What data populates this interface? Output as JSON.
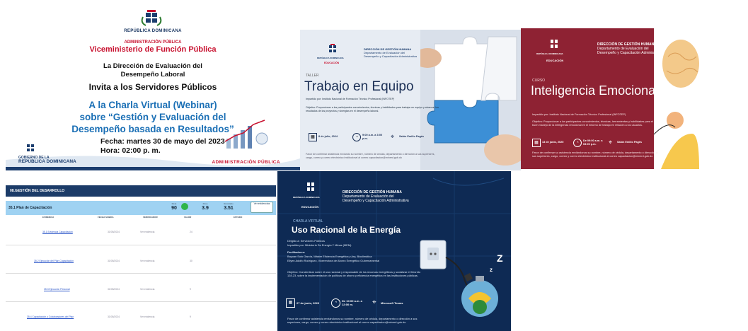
{
  "webinar": {
    "republica": "REPÚBLICA DOMINICANA",
    "administracion": "ADMINISTRACIÓN PÚBLICA",
    "viceministerio": "Viceministerio de Función Pública",
    "direccion_line1": "La Dirección de Evaluación del",
    "direccion_line2": "Desempeño Laboral",
    "invita": "Invita a los Servidores Públicos",
    "charla_line1": "A la Charla Virtual (Webinar)",
    "charla_line2": "sobre “Gestión y Evaluación del",
    "charla_line3": "Desempeño basada en Resultados”",
    "fecha": "Fecha: martes 30 de mayo del 2023",
    "hora": "Hora: 02:00 p. m.",
    "gobierno": "GOBIERNO DE LA",
    "gobierno_rd": "REPÚBLICA DOMINICANA",
    "footer_admin": "ADMINISTRACIÓN PÚBLICA",
    "colors": {
      "red": "#c8102e",
      "blue": "#1a6fb5"
    }
  },
  "trabajo": {
    "republica": "REPÚBLICA DOMINICANA",
    "educacion": "EDUCACIÓN",
    "dgh_line1": "DIRECCIÓN DE GESTIÓN HUMANA",
    "dgh_line2": "Departamento de Evaluación del",
    "dgh_line3": "Desempeño y Capacitación Administrativa",
    "taller": "TALLER",
    "title": "Trabajo en Equipo",
    "impartido": "Impartido por: Instituto Nacional de Formación Técnico Profesional (INFOTEP)",
    "objetivo": "Objetivo: Proporcionar a los participantes conocimientos, técnicas y habilidades para trabajar en equipo y alcanzar los resultados de los proyectos y sinergias en el desempeño laboral.",
    "fecha": "8 de julio, 2024",
    "hora": "9:00 a.m. a 3:00 p.m.",
    "lugar": "Salón Emilio Pagés",
    "nota": "Favor de confirmar asistencia enviando su nombre, número de cédula, departamento o dirección a sus superiores, cargo, correo y correo electrónico institucional al correo capacitacion@minerd.gob.do"
  },
  "inteligencia": {
    "republica": "REPÚBLICA DOMINICANA",
    "educacion": "EDUCACIÓN",
    "dgh_line1": "DIRECCIÓN DE GESTIÓN HUMANA",
    "dgh_line2": "Departamento de Evaluación del",
    "dgh_line3": "Desempeño y Capacitación Administrativa",
    "curso": "CURSO",
    "title": "Inteligencia Emocional",
    "impartido": "Impartido por: Instituto Nacional de Formación Técnico Profesional (INFOTEP)",
    "objetivo": "Objetivo: Proporcionar a los participantes conocimientos, técnicas, herramientas y habilidades para el buen manejo de la inteligencia emocional en el entorno de trabajo en relación a los usuarios.",
    "fecha": "13 de junio, 2025",
    "hora": "De 09:00 a.m. a 03:00 p.m.",
    "lugar": "Salón Emilio Pagés",
    "nota": "Favor de confirmar su asistencia enviándonos su nombre, número de cédula, departamento o dirección a sus superiores, cargo, correo y correo electrónico institucional al correo capacitacion@minerd.gob.do"
  },
  "gestion": {
    "header": "08.GESTIÓN DEL DESARROLLO",
    "plan": "35.1 Plan de Capacitación",
    "stats": [
      {
        "label": "Meta",
        "value": "90"
      },
      {
        "label": "Peso",
        "value": "3.9"
      },
      {
        "label": "Resultado",
        "value": "3.51"
      }
    ],
    "button": "Ver evidencias",
    "columns": [
      "EVIDENCIA",
      "FECHA SUBIDA",
      "VERIFICADOR",
      "VALOR",
      "ESTADO"
    ],
    "rows": [
      {
        "link": "35.1 Evidencia Capacitación",
        "fecha": "31/05/2024",
        "verif": "Ver evidencia",
        "valor": "24"
      },
      {
        "link": "35.2 Ejecución del Plan Capacitación",
        "fecha": "31/05/2024",
        "verif": "Ver evidencia",
        "valor": "30"
      },
      {
        "link": "35.3 Ejecución Personal",
        "fecha": "31/05/2024",
        "verif": "Ver evidencia",
        "valor": "9"
      },
      {
        "link": "35.4 Capacitación y Colaboradores del Plan",
        "fecha": "31/05/2024",
        "verif": "Ver evidencia",
        "valor": "9"
      }
    ]
  },
  "energia": {
    "republica": "REPÚBLICA DOMINICANA",
    "educacion": "EDUCACIÓN",
    "dgh_line1": "DIRECCIÓN DE GESTIÓN HUMANA",
    "dgh_line2": "Departamento de Evaluación del",
    "dgh_line3": "Desempeño y Capacitación Administrativa",
    "charla": "CHARLA VIRTUAL",
    "title": "Uso Racional de la Energía",
    "dirigido": "Dirigido a: Servidores Públicos",
    "impartido": "Impartido por: Ministerio De Energía Y Minas (MEM).",
    "facilitadores": "Facilitadores:",
    "fac1": "Bayoan Soto García, Máster Eficiencia Energética y Arq. Bioclimática",
    "fac2": "Ellyen Adolfo Rodríguez, Vicerrectora de Ahorro Energético Gubernamental",
    "objetivo": "Objetivo: Concientizar sobre el uso racional y responsable de los recursos energéticos y socializar el Decreto 128-23, sobre la implementación de políticas de ahorro y eficiencia energética en las instituciones públicas.",
    "fecha": "27 de junio, 2023",
    "hora": "De 10:00 a.m. a 12:00 m.",
    "lugar": "Microsoft Teams",
    "nota": "Favor de confirmar asistencia enviándonos su nombre, número de cédula, departamento o dirección a sus superiores, cargo, correo y correo electrónico institucional al correo capacitacion@minerd.gob.do"
  }
}
